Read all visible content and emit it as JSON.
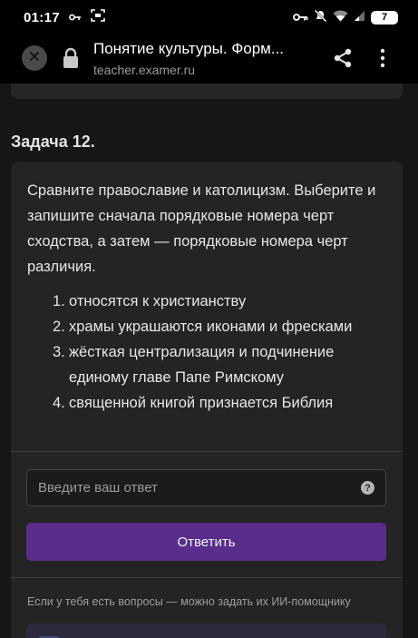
{
  "status_bar": {
    "time": "01:17",
    "battery": "7",
    "icons": [
      "key-icon",
      "screenshot-icon",
      "vpn-key-icon",
      "mute-icon",
      "wifi-icon",
      "signal-icon",
      "battery-icon"
    ]
  },
  "browser": {
    "page_title": "Понятие культуры. Форм...",
    "host": "teacher.examer.ru",
    "icons": [
      "close-icon",
      "lock-icon",
      "share-icon",
      "more-vert-icon"
    ]
  },
  "task": {
    "title": "Задача 12.",
    "question": "Сравните православие и католицизм. Выберите и запишите сначала порядковые номера черт сходства, а затем — порядковые номера черт различия.",
    "options": [
      {
        "num": "1.",
        "text": "относятся к христианству"
      },
      {
        "num": "2.",
        "text": "храмы украшаются иконами и фресками"
      },
      {
        "num": "3.",
        "text": "жёсткая централизация и подчинение единому главе Папе Римскому"
      },
      {
        "num": "4.",
        "text": "священной книгой признается Библия"
      }
    ],
    "answer_placeholder": "Введите ваш ответ",
    "answer_value": "",
    "submit_label": "Ответить",
    "helper_text": "Если у тебя есть вопросы — можно задать их ИИ-помощнику"
  },
  "colors": {
    "background": "#161616",
    "card": "#242424",
    "accent": "#5a2d8c"
  }
}
